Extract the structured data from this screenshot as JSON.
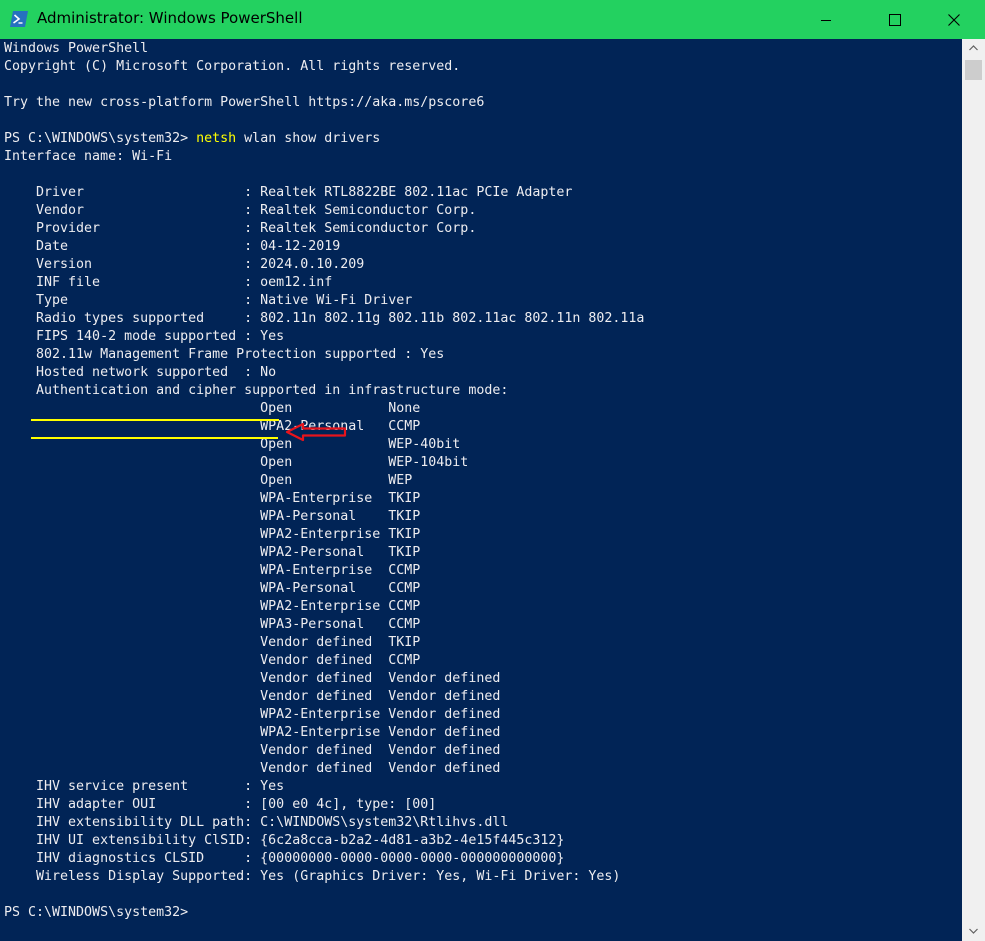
{
  "window": {
    "title": "Administrator: Windows PowerShell",
    "icon": "powershell-icon",
    "controls": [
      "minimize-icon",
      "maximize-icon",
      "close-icon"
    ],
    "titlebar_color": "#23d160",
    "console_background": "#012456"
  },
  "console": {
    "lines_before_command": [
      "Windows PowerShell",
      "Copyright (C) Microsoft Corporation. All rights reserved.",
      "",
      "Try the new cross-platform PowerShell https://aka.ms/pscore6",
      ""
    ],
    "prompt": "PS C:\\WINDOWS\\system32> ",
    "command_name": "netsh",
    "command_args": " wlan show drivers",
    "output_lines": [
      "",
      "Interface name: Wi-Fi",
      "",
      "    Driver                    : Realtek RTL8822BE 802.11ac PCIe Adapter",
      "    Vendor                    : Realtek Semiconductor Corp.",
      "    Provider                  : Realtek Semiconductor Corp.",
      "    Date                      : 04-12-2019",
      "    Version                   : 2024.0.10.209",
      "    INF file                  : oem12.inf",
      "    Type                      : Native Wi-Fi Driver",
      "    Radio types supported     : 802.11n 802.11g 802.11b 802.11ac 802.11n 802.11a",
      "    FIPS 140-2 mode supported : Yes",
      "    802.11w Management Frame Protection supported : Yes",
      "    Hosted network supported  : No",
      "    Authentication and cipher supported in infrastructure mode:",
      "                                Open            None",
      "                                WPA2-Personal   CCMP",
      "                                Open            WEP-40bit",
      "                                Open            WEP-104bit",
      "                                Open            WEP",
      "                                WPA-Enterprise  TKIP",
      "                                WPA-Personal    TKIP",
      "                                WPA2-Enterprise TKIP",
      "                                WPA2-Personal   TKIP",
      "                                WPA-Enterprise  CCMP",
      "                                WPA-Personal    CCMP",
      "                                WPA2-Enterprise CCMP",
      "                                WPA3-Personal   CCMP",
      "                                Vendor defined  TKIP",
      "                                Vendor defined  CCMP",
      "                                Vendor defined  Vendor defined",
      "                                Vendor defined  Vendor defined",
      "                                WPA2-Enterprise Vendor defined",
      "                                WPA2-Enterprise Vendor defined",
      "                                Vendor defined  Vendor defined",
      "                                Vendor defined  Vendor defined",
      "    IHV service present       : Yes",
      "    IHV adapter OUI           : [00 e0 4c], type: [00]",
      "    IHV extensibility DLL path: C:\\WINDOWS\\system32\\Rtlihvs.dll",
      "    IHV UI extensibility ClSID: {6c2a8cca-b2a2-4d81-a3b2-4e15f445c312}",
      "    IHV diagnostics CLSID     : {00000000-0000-0000-0000-000000000000}",
      "    Wireless Display Supported: Yes (Graphics Driver: Yes, Wi-Fi Driver: Yes)",
      ""
    ],
    "final_prompt": "PS C:\\WINDOWS\\system32>",
    "text_color": "#eeedf0",
    "command_color": "#ffff00"
  },
  "annotations": {
    "highlight_color": "#ffff00",
    "arrow_color": "#e8141c",
    "arrow_icon": "red-arrow-icon"
  }
}
